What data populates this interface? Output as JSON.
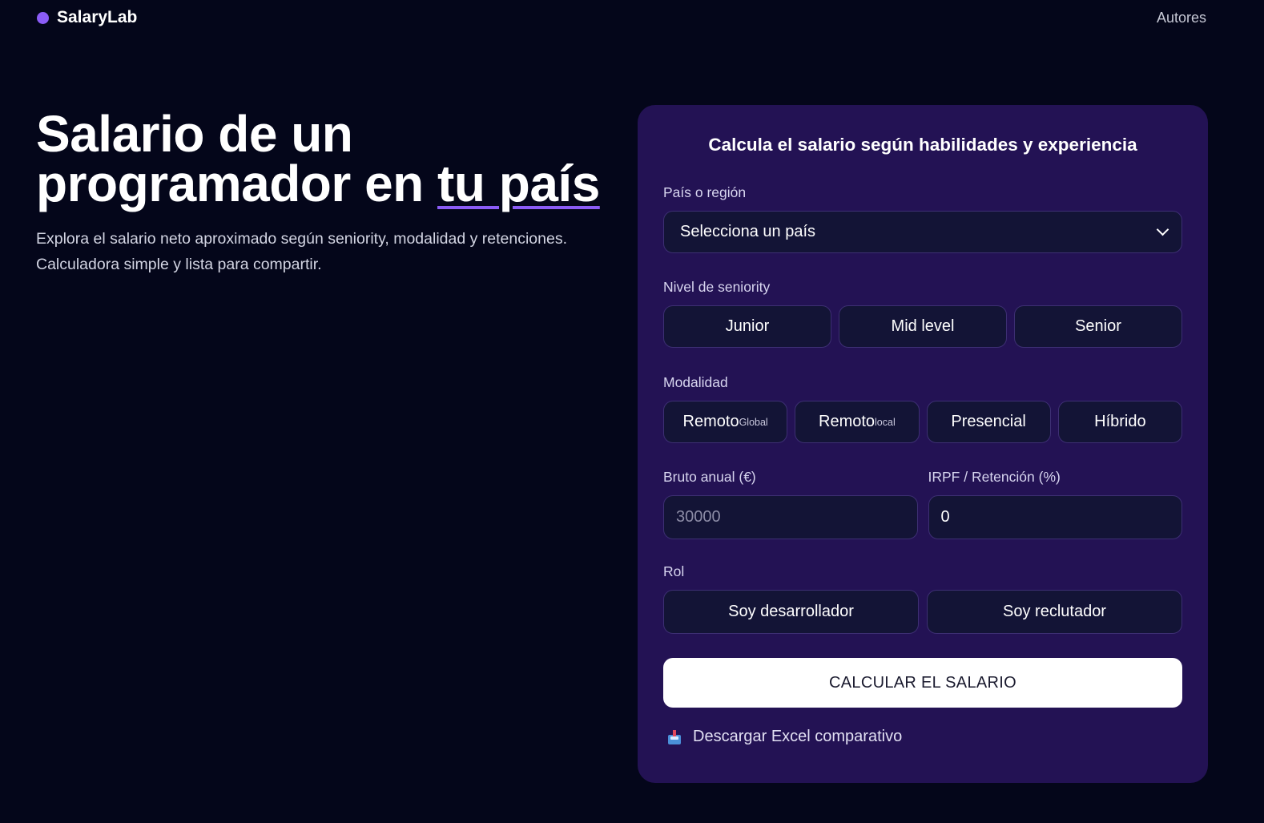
{
  "header": {
    "brand": "SalaryLab",
    "nav_link": "Autores"
  },
  "hero": {
    "title_line1": "Salario de un",
    "title_line2_prefix": "programador en",
    "title_line2_accent": "tu país",
    "subtitle_line1": "Explora el salario neto aproximado según seniority, modalidad y retenciones.",
    "subtitle_line2": "Calculadora simple y lista para compartir."
  },
  "form": {
    "title": "Calcula el salario según habilidades y experiencia",
    "country": {
      "label": "País o región",
      "selected": "Selecciona un país"
    },
    "seniority": {
      "label": "Nivel de seniority",
      "options": [
        "Junior",
        "Mid level",
        "Senior"
      ]
    },
    "modalidad": {
      "label": "Modalidad",
      "options": [
        {
          "label": "Remoto",
          "sup": "Global"
        },
        {
          "label": "Remoto",
          "sup": "local"
        },
        {
          "label": "Presencial",
          "sup": ""
        },
        {
          "label": "Híbrido",
          "sup": ""
        }
      ]
    },
    "bruto": {
      "label": "Bruto anual (€)",
      "value": "",
      "placeholder": "30000"
    },
    "irpf": {
      "label": "IRPF / Retención (%)",
      "value": "0"
    },
    "rol": {
      "label": "Rol",
      "options": [
        "Soy desarrollador",
        "Soy reclutador"
      ]
    },
    "submit_label": "CALCULAR EL SALARIO",
    "download_label": "Descargar Excel comparativo"
  },
  "colors": {
    "background": "#04061a",
    "card": "#231254",
    "accent": "#8b5cf6",
    "control_bg": "#131436"
  },
  "icons": {
    "brand": "brand-dot-icon",
    "select": "chevron-down-icon",
    "download": "download-box-icon"
  }
}
